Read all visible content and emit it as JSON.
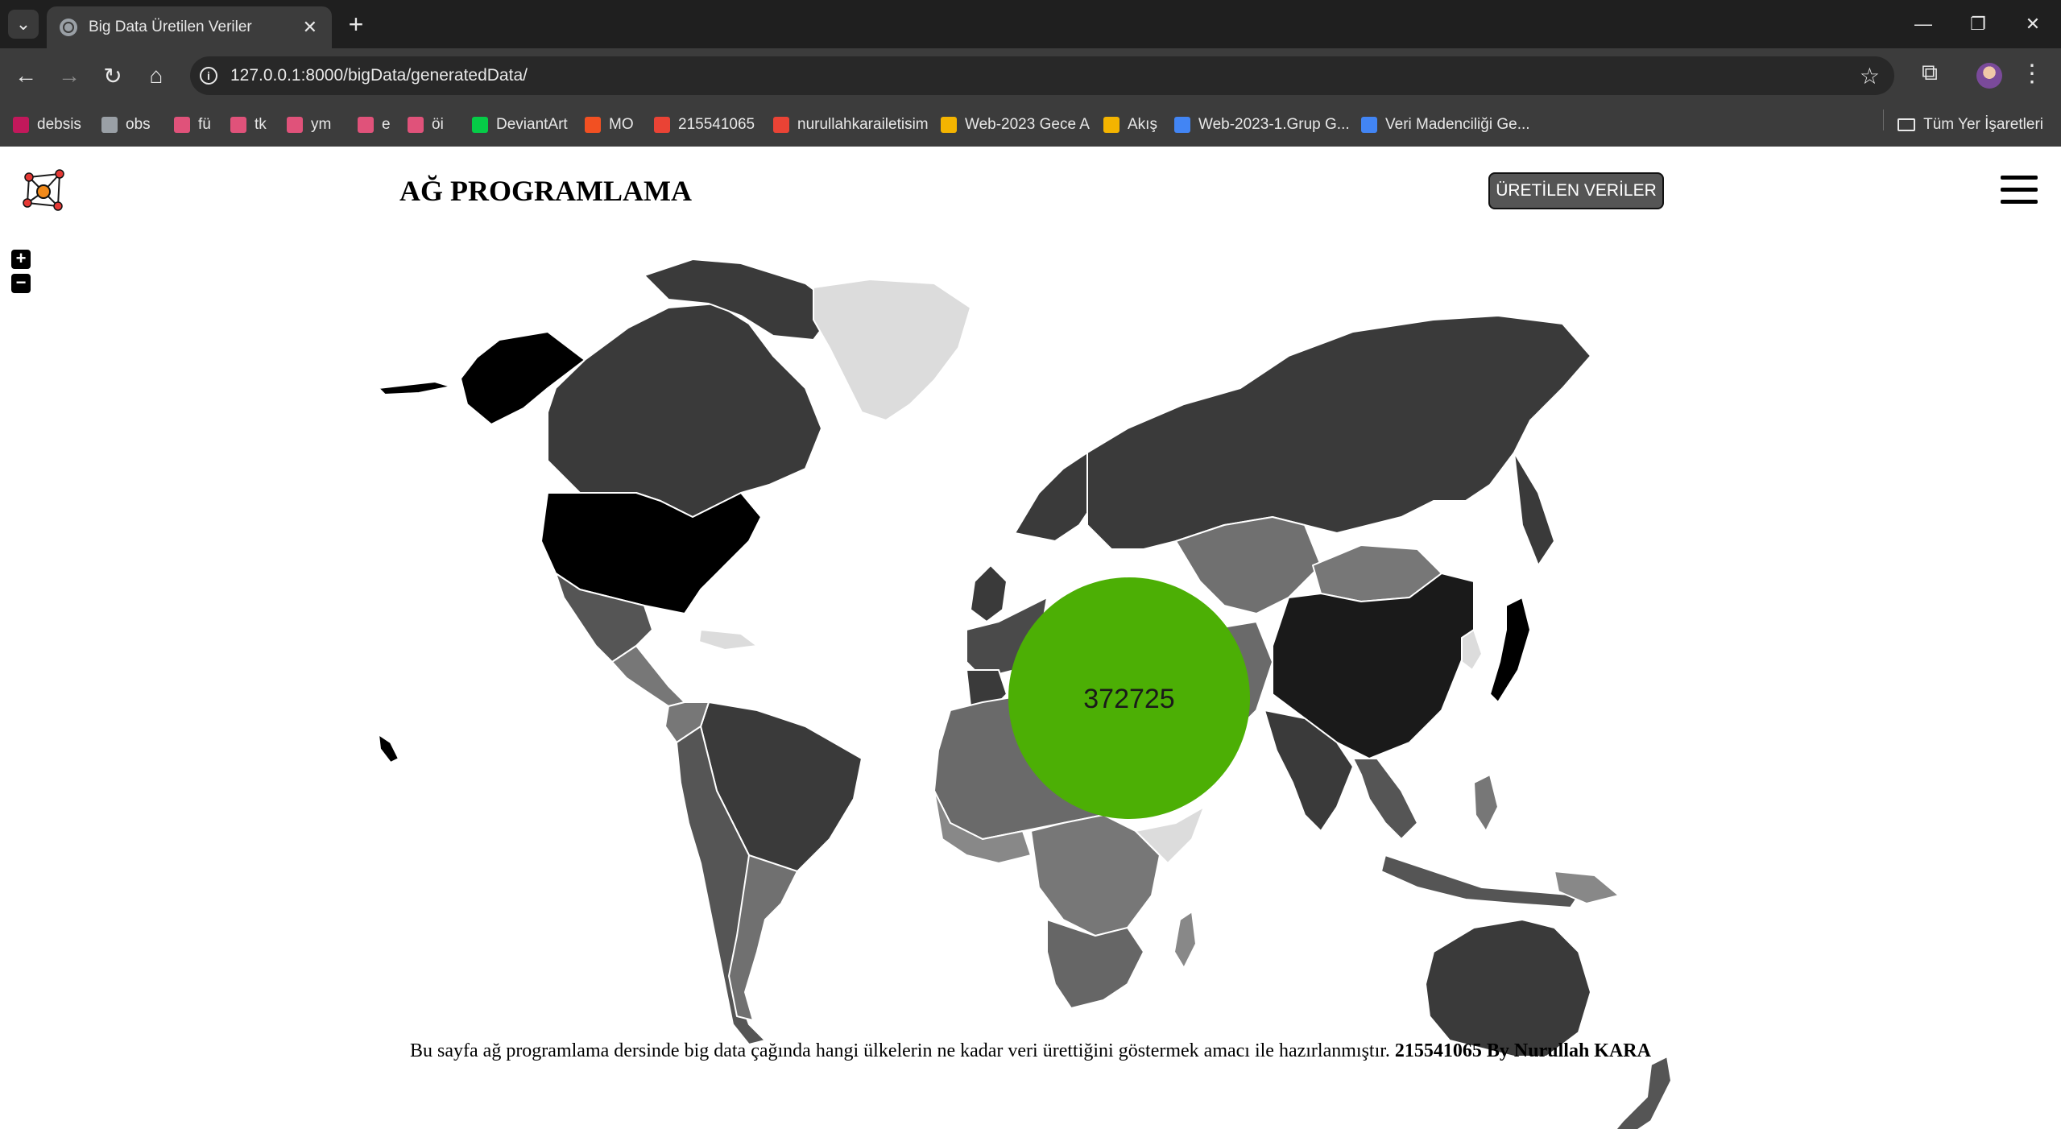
{
  "browser": {
    "tab_title": "Big Data Üretilen Veriler",
    "url": "127.0.0.1:8000/bigData/generatedData/",
    "bookmarks": [
      {
        "label": "debsis",
        "color": "#c2185b"
      },
      {
        "label": "obs",
        "color": "#9aa0a6"
      },
      {
        "label": "fü",
        "color": "#e0527a"
      },
      {
        "label": "tk",
        "color": "#e0527a"
      },
      {
        "label": "ym",
        "color": "#e0527a"
      },
      {
        "label": "e",
        "color": "#e0527a"
      },
      {
        "label": "öi",
        "color": "#e0527a"
      },
      {
        "label": "DeviantArt",
        "color": "#05cc47"
      },
      {
        "label": "MO",
        "color": "#f25022"
      },
      {
        "label": "215541065",
        "color": "#ea4335"
      },
      {
        "label": "nurullahkarailetisim",
        "color": "#ea4335"
      },
      {
        "label": "Web-2023 Gece A",
        "color": "#f4b400"
      },
      {
        "label": "Akış",
        "color": "#f4b400"
      },
      {
        "label": "Web-2023-1.Grup G...",
        "color": "#4285f4"
      },
      {
        "label": "Veri Madenciliği Ge...",
        "color": "#4285f4"
      }
    ],
    "all_bookmarks": "Tüm Yer İşaretleri"
  },
  "header": {
    "title": "AĞ PROGRAMLAMA",
    "button_label": "ÜRETİLEN VERİLER"
  },
  "map": {
    "bubble_value": "372725",
    "bubble_color": "#4caf05",
    "zoom_in": "+",
    "zoom_out": "−"
  },
  "footer": {
    "text": "Bu sayfa ağ programlama dersinde big data çağında hangi ülkelerin ne kadar veri ürettiğini göstermek amacı ile hazırlanmıştır.",
    "author": "215541065 By Nurullah KARA"
  }
}
